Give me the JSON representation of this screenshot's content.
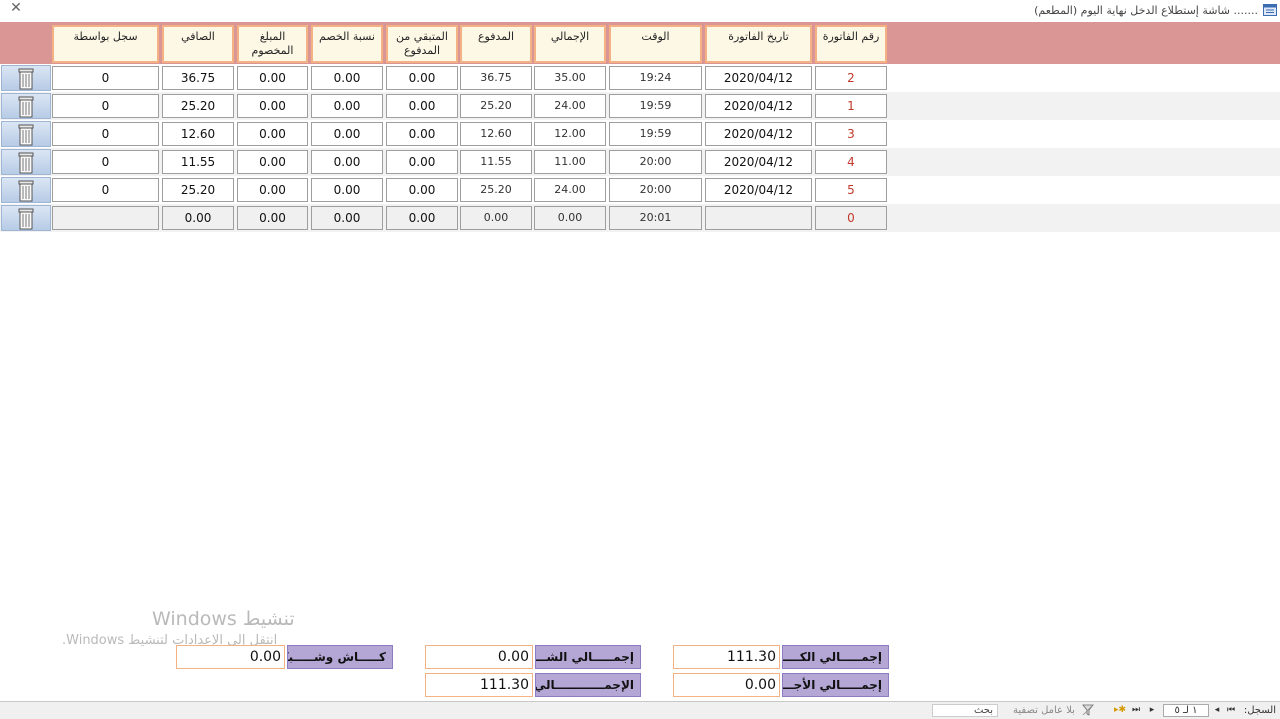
{
  "window": {
    "title": "....... شاشة إستطلاع الدخل نهاية اليوم (المطعم)",
    "icon": "app-form-icon",
    "close_icon": "close-icon"
  },
  "columns": [
    "رقم الفاتورة",
    "تاريخ الفاتورة",
    "الوقت",
    "الإجمالي",
    "المدفوع",
    "المتبقي من المدفوع",
    "نسبة الخصم",
    "المبلغ المخصوم",
    "الصافي",
    "سجل بواسطة"
  ],
  "rows": [
    {
      "invoice": "2",
      "date": "2020/04/12",
      "time": "19:24",
      "total": "35.00",
      "paid": "36.75",
      "remaining": "0.00",
      "discount_pct": "0.00",
      "discount_amt": "0.00",
      "net": "36.75",
      "by": "0"
    },
    {
      "invoice": "1",
      "date": "2020/04/12",
      "time": "19:59",
      "total": "24.00",
      "paid": "25.20",
      "remaining": "0.00",
      "discount_pct": "0.00",
      "discount_amt": "0.00",
      "net": "25.20",
      "by": "0"
    },
    {
      "invoice": "3",
      "date": "2020/04/12",
      "time": "19:59",
      "total": "12.00",
      "paid": "12.60",
      "remaining": "0.00",
      "discount_pct": "0.00",
      "discount_amt": "0.00",
      "net": "12.60",
      "by": "0"
    },
    {
      "invoice": "4",
      "date": "2020/04/12",
      "time": "20:00",
      "total": "11.00",
      "paid": "11.55",
      "remaining": "0.00",
      "discount_pct": "0.00",
      "discount_amt": "0.00",
      "net": "11.55",
      "by": "0"
    },
    {
      "invoice": "5",
      "date": "2020/04/12",
      "time": "20:00",
      "total": "24.00",
      "paid": "25.20",
      "remaining": "0.00",
      "discount_pct": "0.00",
      "discount_amt": "0.00",
      "net": "25.20",
      "by": "0"
    },
    {
      "invoice": "0",
      "date": "",
      "time": "20:01",
      "total": "0.00",
      "paid": "0.00",
      "remaining": "0.00",
      "discount_pct": "0.00",
      "discount_amt": "0.00",
      "net": "0.00",
      "by": ""
    }
  ],
  "totals": {
    "cash_label": "إجمـــــالي الكــــــاش",
    "cash_value": "111.30",
    "credit_label": "إجمـــــالي الأجـــــل",
    "credit_value": "0.00",
    "network_label": "إجمـــــالي الشـــبكة",
    "network_value": "0.00",
    "grand_label": "الإجمــــــــــــالي",
    "grand_value": "111.30",
    "cash_network_label": "كـــــاش وشـــــبكة",
    "cash_network_value": "0.00"
  },
  "watermark": {
    "title": "تنشيط Windows",
    "subtitle": "انتقل إلى الإعدادات لتنشيط Windows."
  },
  "statusbar": {
    "record_label": "السجل:",
    "record_value": "١ لـ ٥",
    "filter_label": "بلا عامل تصفية",
    "search_label": "بحث"
  }
}
